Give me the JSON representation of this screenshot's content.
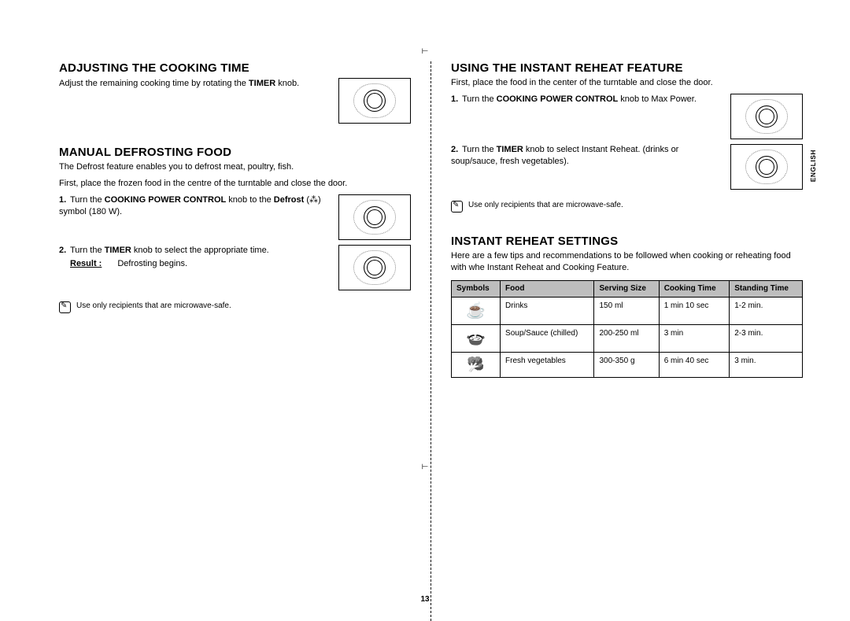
{
  "lang_label": "ENGLISH",
  "page_number": "13",
  "left": {
    "h1": "ADJUSTING THE COOKING TIME",
    "p1a": "Adjust the remaining cooking time by rotating the ",
    "p1b": "TIMER",
    "p1c": " knob.",
    "h2": "MANUAL DEFROSTING FOOD",
    "p2": "The Defrost feature enables you to defrost meat, poultry, fish.",
    "p3": "First, place the frozen food in the centre of the turntable and close the door.",
    "s1_num": "1.",
    "s1a": "Turn the ",
    "s1b": "COOKING POWER CONTROL",
    "s1c": " knob to the ",
    "s1d": "Defrost",
    "s1e": " (⁂) symbol (180 W).",
    "s2_num": "2.",
    "s2a": "Turn the ",
    "s2b": "TIMER",
    "s2c": " knob to select the appropriate time.",
    "result_label": "Result :",
    "result_text": "Defrosting begins.",
    "note": "Use only recipients that are microwave-safe."
  },
  "right": {
    "h1": "USING THE INSTANT REHEAT FEATURE",
    "p1": "First, place the food in the center of the turntable and close the door.",
    "s1_num": "1.",
    "s1a": "Turn the ",
    "s1b": "COOKING POWER CONTROL",
    "s1c": " knob to Max Power.",
    "s2_num": "2.",
    "s2a": "Turn the ",
    "s2b": "TIMER",
    "s2c": " knob to select Instant Reheat. (drinks or soup/sauce, fresh vegetables).",
    "note": "Use only recipients that are microwave-safe.",
    "h2": "INSTANT REHEAT SETTINGS",
    "p2": "Here are a few tips and recommendations to be followed when cooking or reheating food with whe Instant Reheat and Cooking Feature.",
    "table": {
      "head": {
        "c1": "Symbols",
        "c2": "Food",
        "c3": "Serving Size",
        "c4": "Cooking Time",
        "c5": "Standing Time"
      },
      "rows": [
        {
          "sym": "cup",
          "food": "Drinks",
          "size": "150 ml",
          "cook": "1 min 10 sec",
          "stand": "1-2 min."
        },
        {
          "sym": "bowl",
          "food": "Soup/Sauce (chilled)",
          "size": "200-250 ml",
          "cook": "3 min",
          "stand": "2-3 min."
        },
        {
          "sym": "veg",
          "food": "Fresh vegetables",
          "size": "300-350 g",
          "cook": "6 min 40 sec",
          "stand": "3 min."
        }
      ]
    }
  }
}
